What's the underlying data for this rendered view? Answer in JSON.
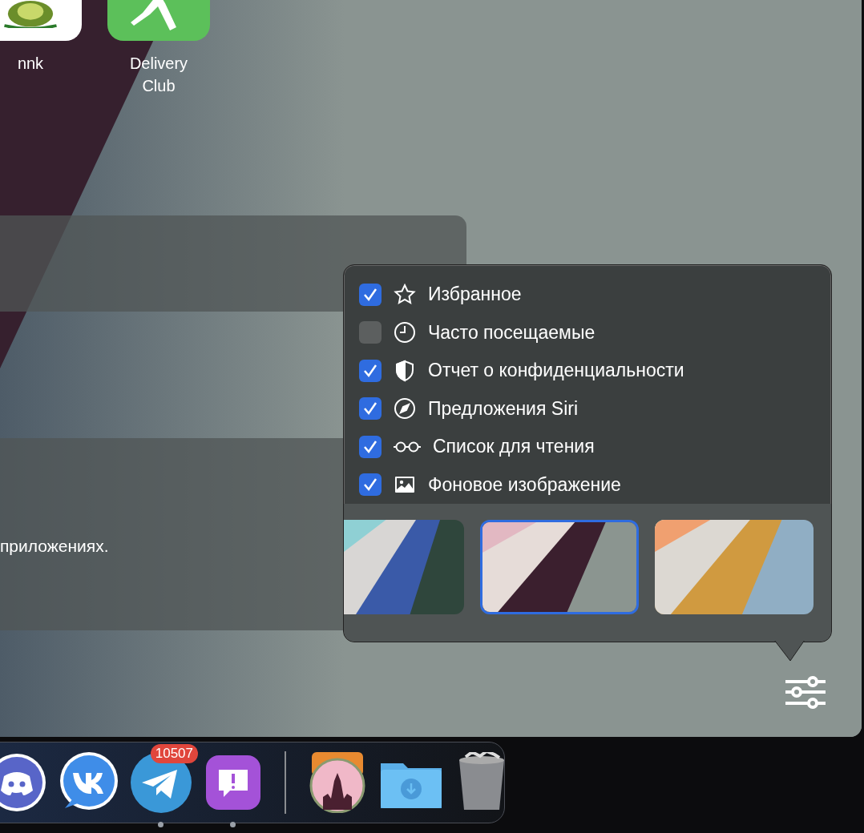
{
  "favorites": [
    {
      "label": "nnk",
      "kind": "fruit"
    },
    {
      "label": "Delivery\nClub",
      "kind": "runner"
    }
  ],
  "privacy_card": {
    "text": "приложениях."
  },
  "popover": {
    "items": [
      {
        "label": "Избранное",
        "checked": true,
        "kind": "star"
      },
      {
        "label": "Часто посещаемые",
        "checked": false,
        "kind": "clock"
      },
      {
        "label": "Отчет о конфиденциальности",
        "checked": true,
        "kind": "shield"
      },
      {
        "label": "Предложения Siri",
        "checked": true,
        "kind": "compass"
      },
      {
        "label": "Список для чтения",
        "checked": true,
        "kind": "glasses"
      },
      {
        "label": "Фоновое изображение",
        "checked": true,
        "kind": "picture"
      }
    ],
    "wallpapers": [
      {
        "selected": false
      },
      {
        "selected": true
      },
      {
        "selected": false
      }
    ]
  },
  "dock": {
    "apps": [
      {
        "kind": "discord",
        "running": false
      },
      {
        "kind": "vk",
        "running": false
      },
      {
        "kind": "telegram",
        "running": true,
        "badge": "10507"
      },
      {
        "kind": "feedback",
        "running": true
      }
    ],
    "others": [
      {
        "kind": "game"
      },
      {
        "kind": "downloads"
      },
      {
        "kind": "trash"
      }
    ]
  }
}
